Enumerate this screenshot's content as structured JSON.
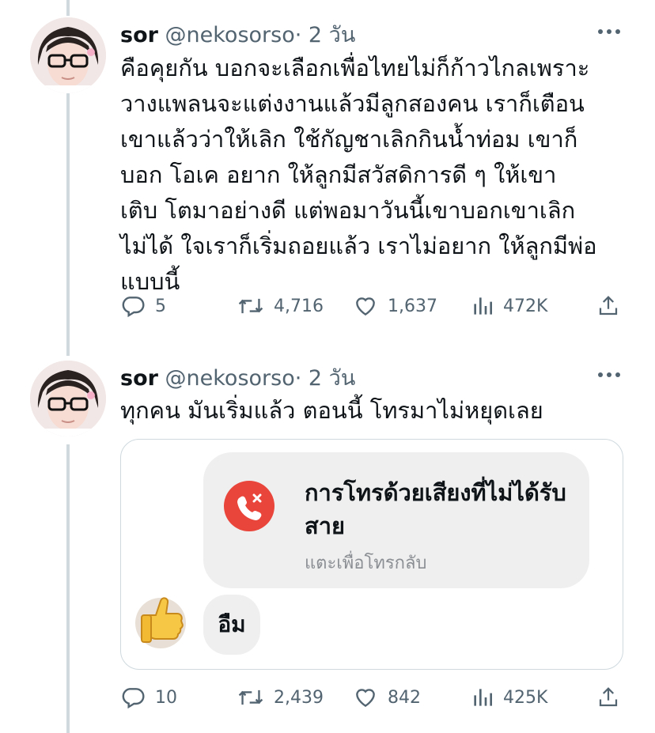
{
  "tweets": [
    {
      "name": "sor",
      "handle": "@nekosorso",
      "separator": "·",
      "time": "2 วัน",
      "text": "คือคุยกัน บอกจะเลือกเพื่อไทยไม่ก็ก้าวไกลเพราะ\nวางแพลนจะแต่งงานแล้วมีลูกสองคน เราก็เตือน\nเขาแล้วว่าให้เลิก ใช้กัญชาเลิกกินน้ำท่อม เขาก็\nบอก โอเค อยาก ให้ลูกมีสวัสดิการดี ๆ ให้เขา\nเติบ โตมาอย่างดี แต่พอมาวันนี้เขาบอกเขาเลิก\nไม่ได้ ใจเราก็เริ่มถอยแล้ว เราไม่อยาก ให้ลูกมีพ่อ\nแบบนี้",
      "replies": "5",
      "retweets": "4,716",
      "likes": "1,637",
      "views": "472K"
    },
    {
      "name": "sor",
      "handle": "@nekosorso",
      "separator": "·",
      "time": "2 วัน",
      "text": "ทุกคน มันเริ่มแล้ว ตอนนี้ โทรมาไม่หยุดเลย",
      "replies": "10",
      "retweets": "2,439",
      "likes": "842",
      "views": "425K",
      "image": {
        "call_title": "การโทรด้วยเสียงที่ไม่ได้รับสาย",
        "call_subtitle": "แตะเพื่อโทรกลับ",
        "reply_text": "อืม"
      }
    }
  ],
  "icons": {
    "reply": "reply-icon",
    "retweet": "retweet-icon",
    "like": "heart-icon",
    "views": "views-icon",
    "share": "share-icon",
    "more": "more-icon",
    "missed_call": "missed-call-icon",
    "thumbs_up": "thumbs-up-icon"
  },
  "colors": {
    "text": "#0f1419",
    "secondary": "#536471",
    "thread_line": "#cfd9de",
    "missed_call": "#e9453a",
    "bubble": "#efefef"
  }
}
